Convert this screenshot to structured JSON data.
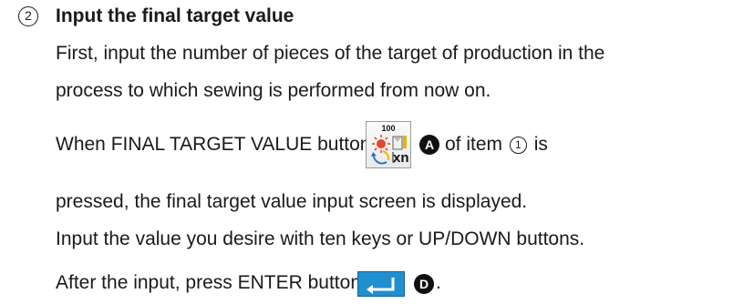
{
  "section": {
    "step_marker": "2",
    "title": "Input the final target value",
    "paragraph1_line1": "First, input the number of pieces of the target of production in the",
    "paragraph1_line2": "process to which sewing is performed from now on.",
    "line3_before": "When FINAL TARGET VALUE button",
    "line3_badge": "A",
    "line3_of_item": "of item",
    "line3_item_num": "1",
    "line3_after": "is",
    "line4": "pressed, the final target value input screen is displayed.",
    "line5": "Input the value you desire with ten keys or UP/DOWN buttons.",
    "line6_before": "After the input, press ENTER button",
    "line6_badge": "D",
    "line6_after": "."
  },
  "final_target_button": {
    "value_label": "100",
    "icon": "final-target-value-icon",
    "multiplier_label": "xn"
  },
  "enter_button": {
    "icon": "enter-return-icon",
    "color": "#1f8fd0"
  }
}
